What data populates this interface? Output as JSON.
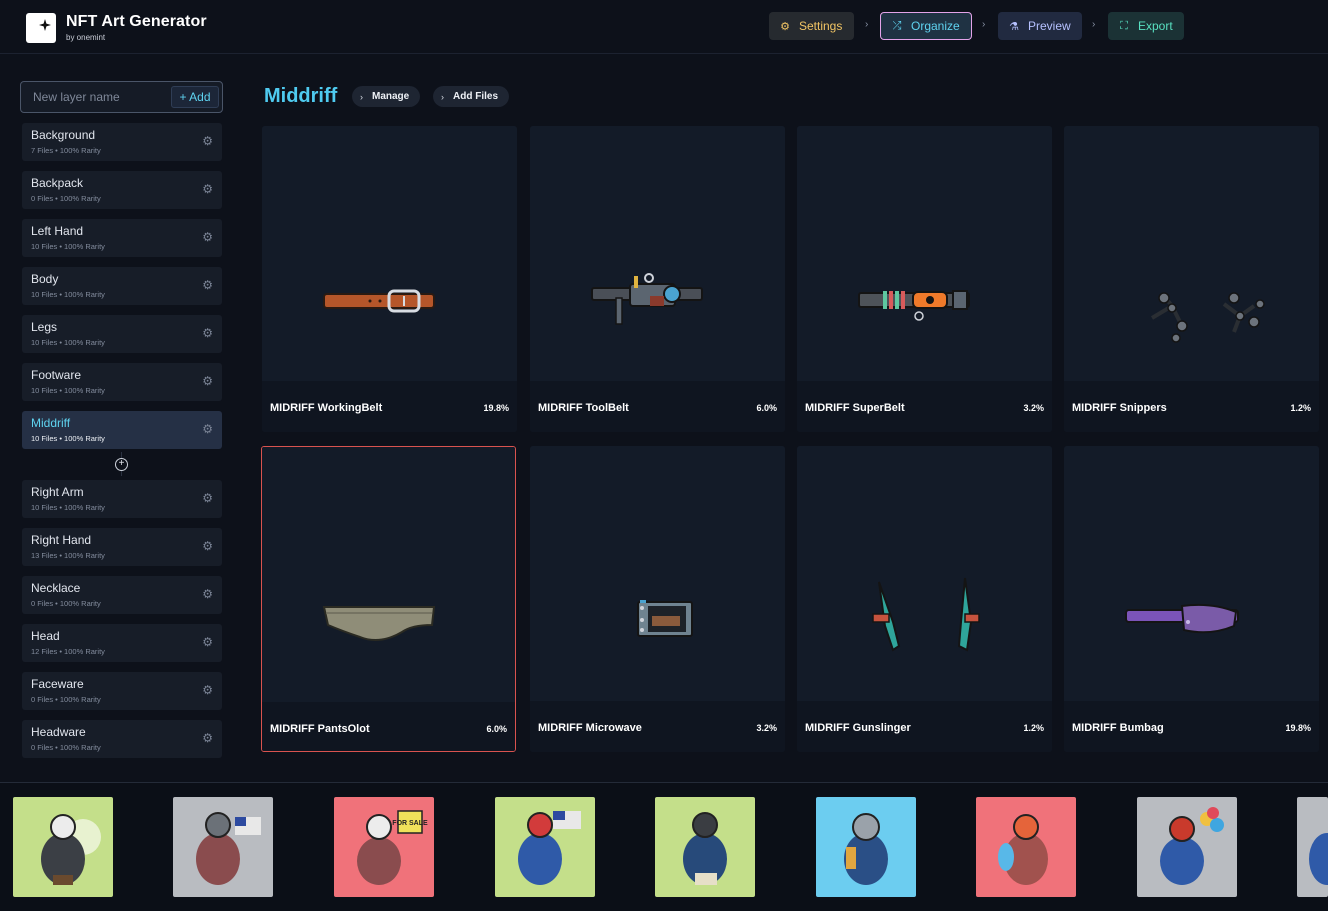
{
  "app": {
    "title": "NFT Art Generator",
    "subtitle": "by onemint"
  },
  "steps": [
    {
      "label": "Settings",
      "icon": "gear-icon"
    },
    {
      "label": "Organize",
      "icon": "shuffle-icon"
    },
    {
      "label": "Preview",
      "icon": "flask-icon"
    },
    {
      "label": "Export",
      "icon": "export-icon"
    }
  ],
  "new_layer": {
    "placeholder": "New layer name",
    "add_label": "+ Add"
  },
  "layers": [
    {
      "name": "Background",
      "meta": "7 Files  •  100% Rarity"
    },
    {
      "name": "Backpack",
      "meta": "0 Files  •  100% Rarity"
    },
    {
      "name": "Left Hand",
      "meta": "10 Files  •  100% Rarity"
    },
    {
      "name": "Body",
      "meta": "10 Files  •  100% Rarity"
    },
    {
      "name": "Legs",
      "meta": "10 Files  •  100% Rarity"
    },
    {
      "name": "Footware",
      "meta": "10 Files  •  100% Rarity"
    },
    {
      "name": "Middriff",
      "meta": "10 Files  •  100% Rarity"
    },
    {
      "name": "Right Arm",
      "meta": "10 Files  •  100% Rarity"
    },
    {
      "name": "Right Hand",
      "meta": "13 Files  •  100% Rarity"
    },
    {
      "name": "Necklace",
      "meta": "0 Files  •  100% Rarity"
    },
    {
      "name": "Head",
      "meta": "12 Files  •  100% Rarity"
    },
    {
      "name": "Faceware",
      "meta": "0 Files  •  100% Rarity"
    },
    {
      "name": "Headware",
      "meta": "0 Files  •  100% Rarity"
    }
  ],
  "main": {
    "title": "Middriff",
    "manage_label": "Manage",
    "add_files_label": "Add Files"
  },
  "traits": [
    {
      "name": "MIDRIFF WorkingBelt",
      "rarity": "19.8%"
    },
    {
      "name": "MIDRIFF ToolBelt",
      "rarity": "6.0%"
    },
    {
      "name": "MIDRIFF SuperBelt",
      "rarity": "3.2%"
    },
    {
      "name": "MIDRIFF Snippers",
      "rarity": "1.2%"
    },
    {
      "name": "MIDRIFF PantsOlot",
      "rarity": "6.0%"
    },
    {
      "name": "MIDRIFF Microwave",
      "rarity": "3.2%"
    },
    {
      "name": "MIDRIFF Gunslinger",
      "rarity": "1.2%"
    },
    {
      "name": "MIDRIFF Bumbag",
      "rarity": "19.8%"
    }
  ],
  "preview_strip": {
    "thumb_backgrounds": [
      "#c4df8a",
      "#b9bcc1",
      "#f0727a",
      "#c4df8a",
      "#c4df8a",
      "#6ccdf0",
      "#f0727a",
      "#b9bcc1",
      "#b9bcc1"
    ],
    "sign_text": "FOR SALE"
  },
  "colors": {
    "accent": "#4fcbf0",
    "selected_border": "#d9534f"
  }
}
